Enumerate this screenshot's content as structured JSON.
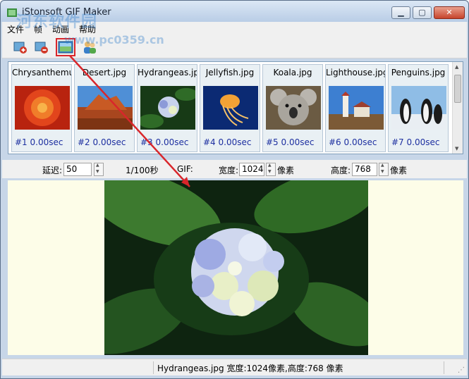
{
  "window": {
    "title": "iStonsoft GIF Maker",
    "controls": {
      "minimize": "▁",
      "maximize": "▢",
      "close": "✕"
    }
  },
  "watermark": {
    "text": "河东软件园",
    "url": "www.pc0359.cn"
  },
  "menu": [
    "文件",
    "帧",
    "动画",
    "帮助"
  ],
  "toolbar": {
    "buttons": [
      "add-frame-icon",
      "remove-frame-icon",
      "image-frame-icon",
      "people-icon"
    ],
    "highlighted": "image-frame-icon",
    "highlight_color": "#d9262b"
  },
  "frames": [
    {
      "name": "Chrysanthemu",
      "caption": "#1  0.00sec"
    },
    {
      "name": "Desert.jpg",
      "caption": "#2  0.00sec"
    },
    {
      "name": "Hydrangeas.jpg",
      "caption": "#3  0.00sec"
    },
    {
      "name": "Jellyfish.jpg",
      "caption": "#4  0.00sec"
    },
    {
      "name": "Koala.jpg",
      "caption": "#5  0.00sec"
    },
    {
      "name": "Lighthouse.jpg",
      "caption": "#6  0.00sec"
    },
    {
      "name": "Penguins.jpg",
      "caption": "#7  0.00sec"
    }
  ],
  "settings": {
    "delay_label": "延迟:",
    "delay_value": "50",
    "delay_unit": "1/100秒",
    "gif_label": "GIF:",
    "width_label": "宽度:",
    "width_value": "1024",
    "width_unit": "像素",
    "height_label": "高度:",
    "height_value": "768",
    "height_unit": "像素"
  },
  "status": {
    "text": "Hydrangeas.jpg 宽度:1024像素,高度:768 像素"
  },
  "colors": {
    "accent_red": "#d9262b",
    "preview_bg": "#fdfde8",
    "caption_blue": "#1d2fa0"
  }
}
